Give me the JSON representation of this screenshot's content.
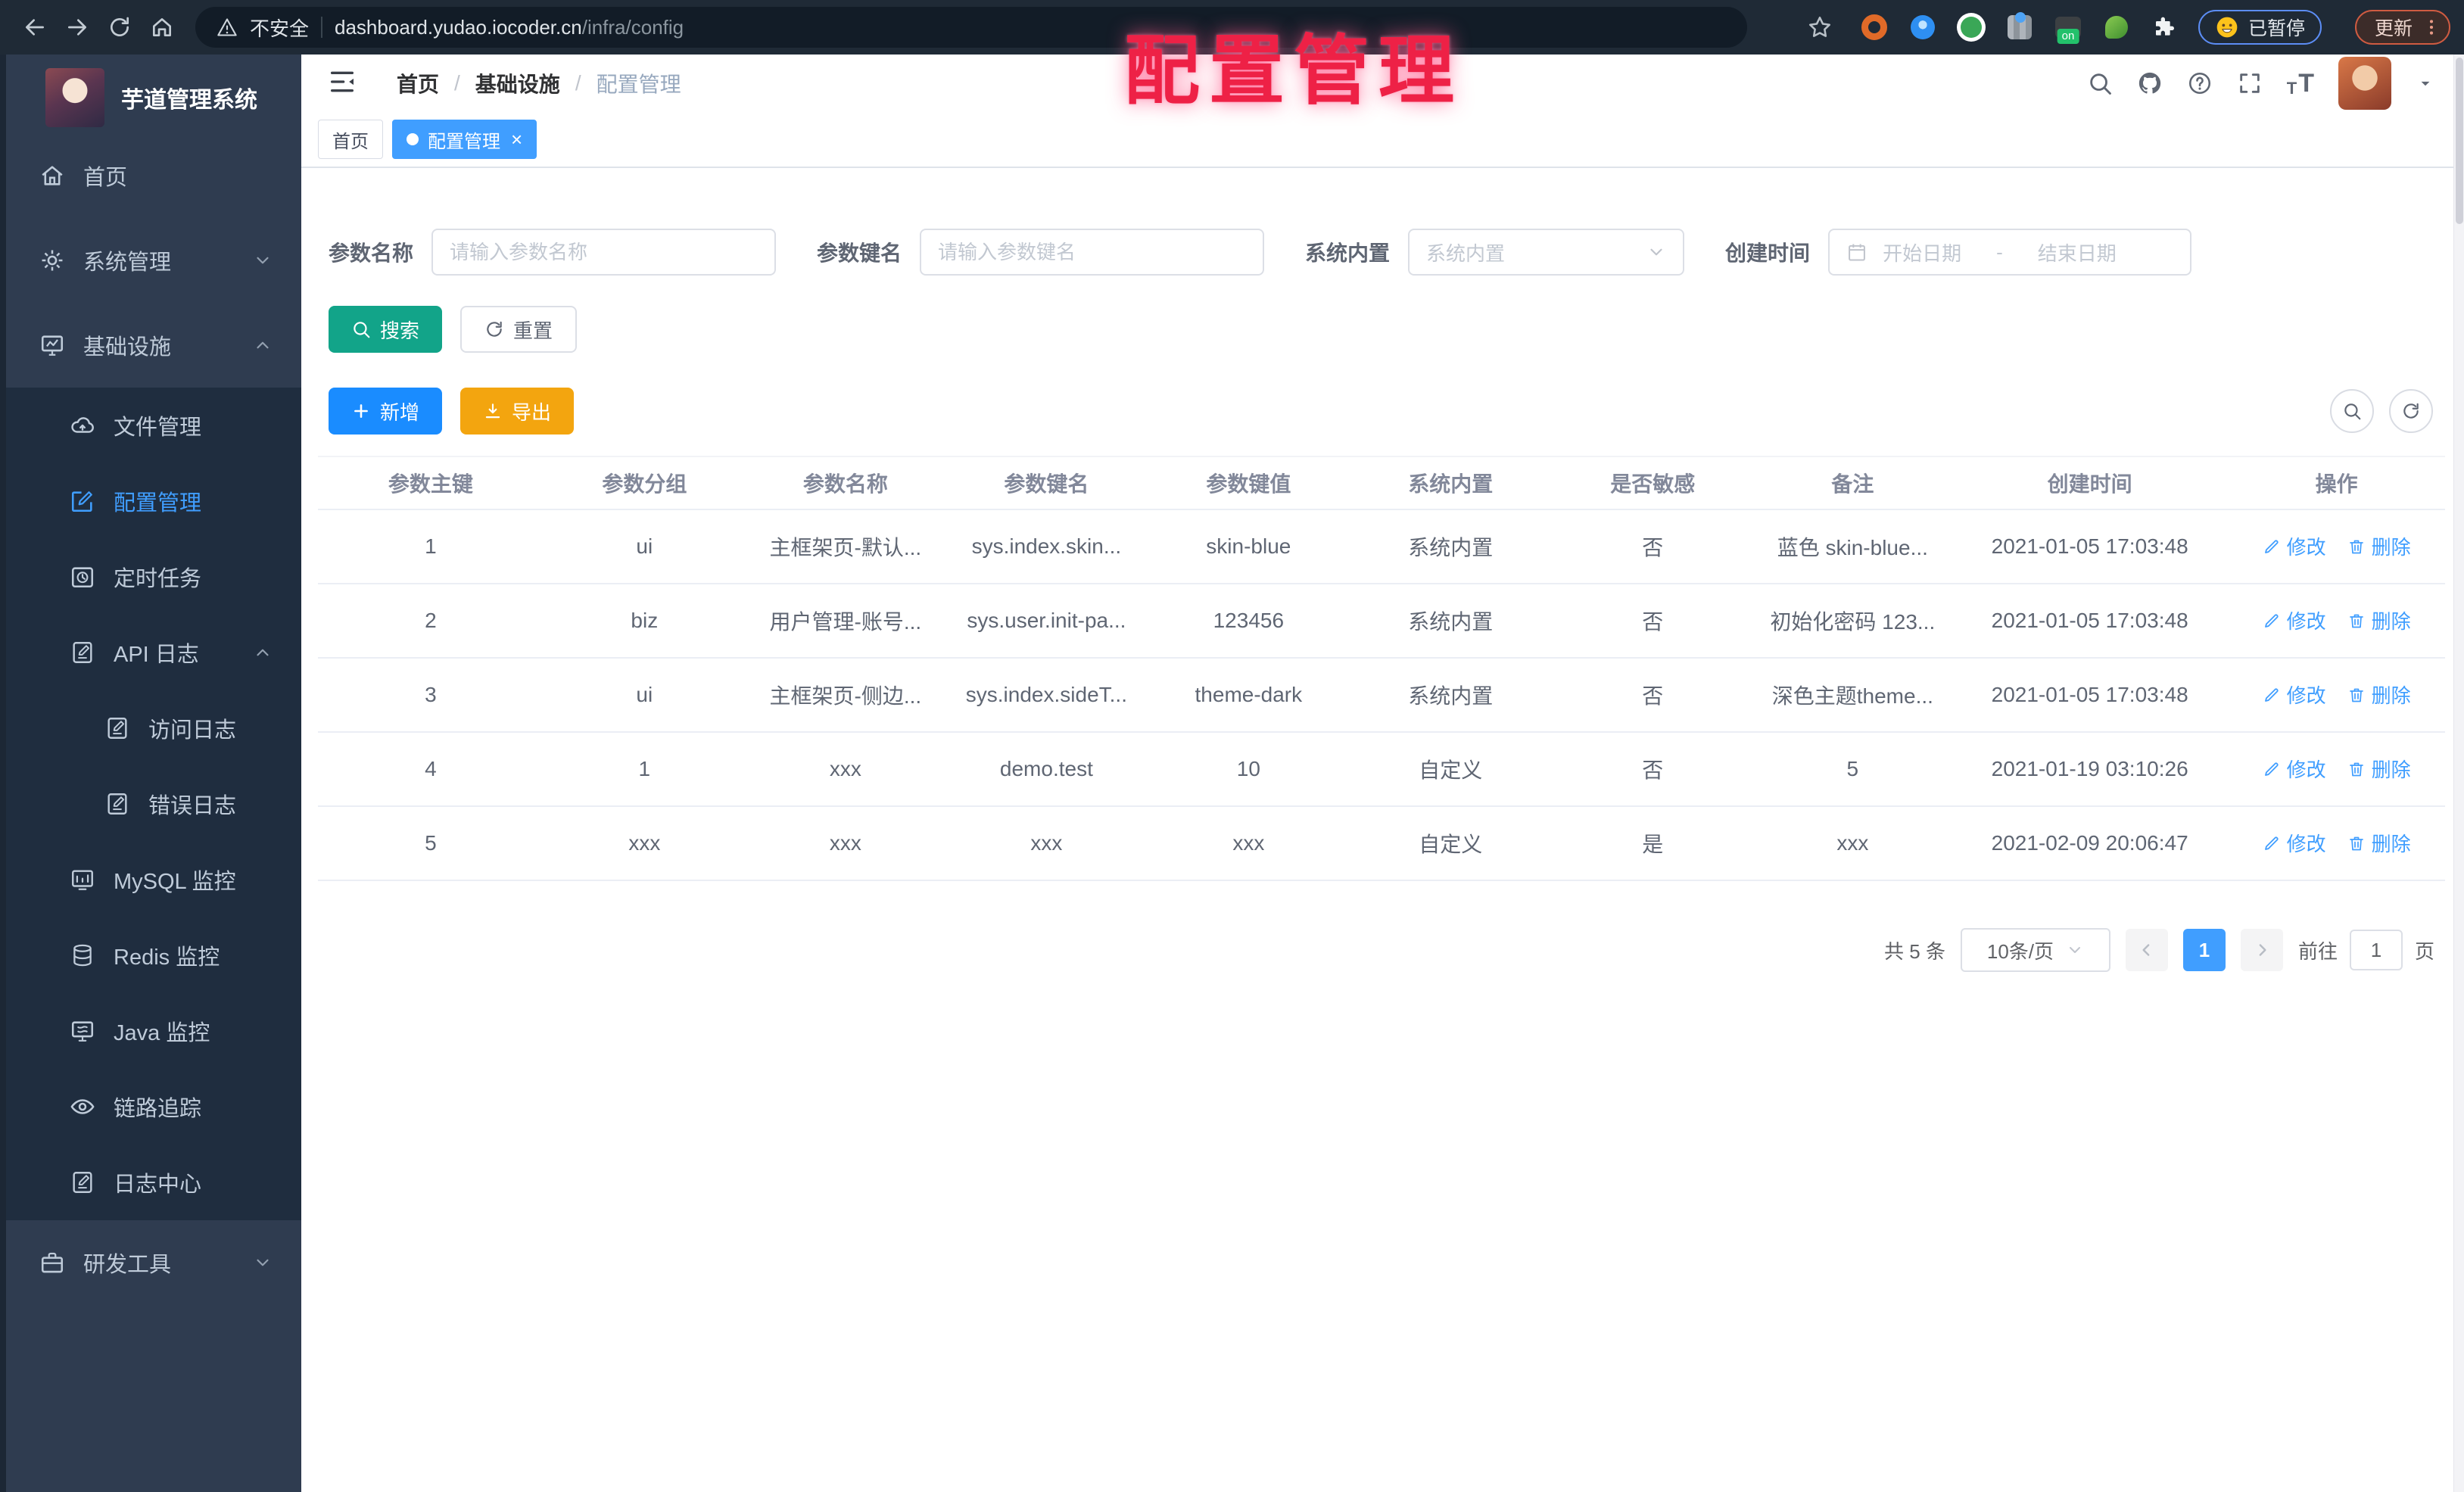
{
  "browser": {
    "security_label": "不安全",
    "url_host": "dashboard.yudao.iocoder.cn",
    "url_path": "/infra/config",
    "paused_label": "已暂停",
    "update_label": "更新"
  },
  "overlay_title": "配置管理",
  "sidebar": {
    "app_title": "芋道管理系统",
    "menu": [
      {
        "label": "首页",
        "icon": "home",
        "level": 1
      },
      {
        "label": "系统管理",
        "icon": "gear",
        "level": 1,
        "expand": "down"
      },
      {
        "label": "基础设施",
        "icon": "monitor",
        "level": 1,
        "expand": "up"
      },
      {
        "label": "文件管理",
        "icon": "cloud",
        "level": 2
      },
      {
        "label": "配置管理",
        "icon": "edit",
        "level": 2,
        "active": true
      },
      {
        "label": "定时任务",
        "icon": "timer",
        "level": 2
      },
      {
        "label": "API 日志",
        "icon": "log",
        "level": 2,
        "expand": "up"
      },
      {
        "label": "访问日志",
        "icon": "log",
        "level": 3
      },
      {
        "label": "错误日志",
        "icon": "log",
        "level": 3
      },
      {
        "label": "MySQL 监控",
        "icon": "mysql",
        "level": 2
      },
      {
        "label": "Redis 监控",
        "icon": "redis",
        "level": 2
      },
      {
        "label": "Java 监控",
        "icon": "java",
        "level": 2
      },
      {
        "label": "链路追踪",
        "icon": "eye",
        "level": 2
      },
      {
        "label": "日志中心",
        "icon": "log",
        "level": 2
      },
      {
        "label": "研发工具",
        "icon": "tool",
        "level": 1,
        "expand": "down"
      }
    ]
  },
  "header": {
    "breadcrumb": [
      {
        "label": "首页"
      },
      {
        "label": "基础设施"
      },
      {
        "label": "配置管理"
      }
    ],
    "separator": "/"
  },
  "tabs": [
    {
      "label": "首页",
      "active": false
    },
    {
      "label": "配置管理",
      "active": true,
      "close": "×"
    }
  ],
  "filters": {
    "param_name_label": "参数名称",
    "param_name_placeholder": "请输入参数名称",
    "param_key_label": "参数键名",
    "param_key_placeholder": "请输入参数键名",
    "builtin_label": "系统内置",
    "builtin_placeholder": "系统内置",
    "create_time_label": "创建时间",
    "start_placeholder": "开始日期",
    "range_separator": "-",
    "end_placeholder": "结束日期"
  },
  "buttons": {
    "search": "搜索",
    "reset": "重置",
    "add": "新增",
    "export": "导出"
  },
  "table": {
    "columns": [
      "参数主键",
      "参数分组",
      "参数名称",
      "参数键名",
      "参数键值",
      "系统内置",
      "是否敏感",
      "备注",
      "创建时间",
      "操作"
    ],
    "rows": [
      [
        "1",
        "ui",
        "主框架页-默认...",
        "sys.index.skin...",
        "skin-blue",
        "系统内置",
        "否",
        "蓝色 skin-blue...",
        "2021-01-05 17:03:48"
      ],
      [
        "2",
        "biz",
        "用户管理-账号...",
        "sys.user.init-pa...",
        "123456",
        "系统内置",
        "否",
        "初始化密码 123...",
        "2021-01-05 17:03:48"
      ],
      [
        "3",
        "ui",
        "主框架页-侧边...",
        "sys.index.sideT...",
        "theme-dark",
        "系统内置",
        "否",
        "深色主题theme...",
        "2021-01-05 17:03:48"
      ],
      [
        "4",
        "1",
        "xxx",
        "demo.test",
        "10",
        "自定义",
        "否",
        "5",
        "2021-01-19 03:10:26"
      ],
      [
        "5",
        "xxx",
        "xxx",
        "xxx",
        "xxx",
        "自定义",
        "是",
        "xxx",
        "2021-02-09 20:06:47"
      ]
    ],
    "edit_label": "修改",
    "delete_label": "删除"
  },
  "pagination": {
    "total": "共 5 条",
    "page_size": "10条/页",
    "current": "1",
    "goto_label": "前往",
    "goto_value": "1",
    "page_unit": "页"
  },
  "colors": {
    "accent_blue": "#409eff",
    "search_teal": "#12a489",
    "add_blue": "#1a8cff",
    "export_yellow": "#f3a50f",
    "sidebar_bg": "#2f3c50",
    "submenu_bg": "#1f2d3f",
    "overlay_red": "#ee2146"
  }
}
